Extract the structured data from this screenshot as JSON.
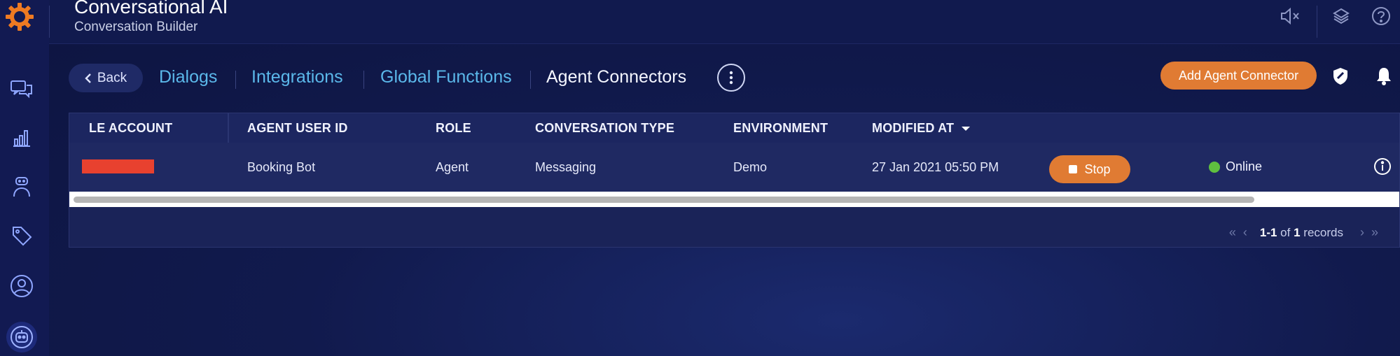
{
  "app": {
    "title": "Conversational AI",
    "subtitle": "Conversation Builder"
  },
  "sidebar": {
    "items": [
      {
        "icon": "chat-icon"
      },
      {
        "icon": "analytics-icon"
      },
      {
        "icon": "agent-icon"
      },
      {
        "icon": "tag-icon"
      },
      {
        "icon": "user-icon"
      },
      {
        "icon": "bot-icon"
      }
    ]
  },
  "topbar": {
    "icons": [
      "mute-icon",
      "layers-icon",
      "help-icon"
    ]
  },
  "nav": {
    "back_label": "Back",
    "tabs": [
      {
        "label": "Dialogs"
      },
      {
        "label": "Integrations"
      },
      {
        "label": "Global Functions"
      },
      {
        "label": "Agent Connectors",
        "active": true
      }
    ]
  },
  "actions": {
    "add_label": "Add Agent Connector"
  },
  "table": {
    "columns": [
      "LE ACCOUNT",
      "AGENT USER ID",
      "ROLE",
      "CONVERSATION TYPE",
      "ENVIRONMENT",
      "MODIFIED AT"
    ],
    "sort_column": "MODIFIED AT",
    "rows": [
      {
        "le_account": "",
        "agent_user_id": "Booking Bot",
        "role": "Agent",
        "conversation_type": "Messaging",
        "environment": "Demo",
        "modified_at": "27 Jan 2021 05:50 PM",
        "action_label": "Stop",
        "status": "Online"
      }
    ]
  },
  "pagination": {
    "range": "1-1",
    "of": "of",
    "total": "1",
    "suffix": "records"
  },
  "colors": {
    "accent": "#e07b33",
    "link": "#5bb8ea",
    "online": "#5fbf3f",
    "redacted": "#e8412f"
  }
}
